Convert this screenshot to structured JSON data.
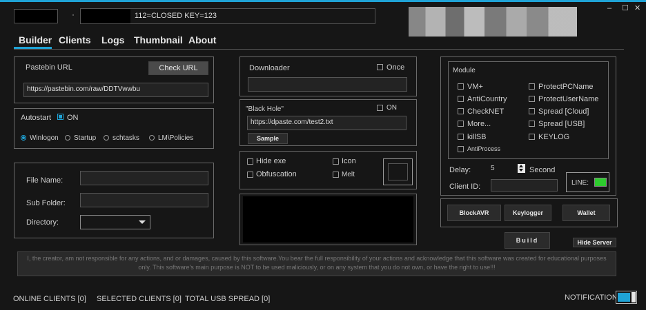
{
  "title_status": "112=CLOSED   KEY=123",
  "title_dot": "·",
  "window": {
    "minimize": "–",
    "maximize": "☐",
    "close": "✕"
  },
  "tabs": [
    "Builder",
    "Clients",
    "Logs",
    "Thumbnail",
    "About"
  ],
  "pastebin": {
    "label": "Pastebin URL",
    "check_button": "Check URL",
    "url": "https://pastebin.com/raw/DDTVwwbu"
  },
  "autostart": {
    "label": "Autostart",
    "on": "ON",
    "options": [
      "Winlogon",
      "Startup",
      "schtasks",
      "LM\\Policies"
    ],
    "selected": "Winlogon"
  },
  "file": {
    "file_name_label": "File Name:",
    "sub_folder_label": "Sub Folder:",
    "directory_label": "Directory:",
    "file_name": "",
    "sub_folder": "",
    "directory": ""
  },
  "downloader": {
    "label": "Downloader",
    "once": "Once",
    "url": ""
  },
  "blackhole": {
    "label": "\"Black Hole\"",
    "on": "ON",
    "url": "https://dpaste.com/test2.txt",
    "sample_button": "Sample"
  },
  "options": {
    "hide_exe": "Hide exe",
    "icon": "Icon",
    "obfuscation": "Obfuscation",
    "melt": "Melt"
  },
  "module": {
    "label": "Module",
    "left": [
      "VM+",
      "AntiCountry",
      "CheckNET",
      "More...",
      "killSB",
      "AntiProcess"
    ],
    "right": [
      "ProtectPCName",
      "ProtectUserName",
      "Spread [Cloud]",
      "Spread [USB]",
      "KEYLOG"
    ]
  },
  "delay": {
    "label": "Delay:",
    "value": "5",
    "unit": "Second"
  },
  "client_id": {
    "label": "Client ID:",
    "value": ""
  },
  "line": {
    "label": "LINE:",
    "color": "#2ecc2e"
  },
  "actions": {
    "block_avr": "BlockAVR",
    "keylogger": "Keylogger",
    "wallet": "Wallet"
  },
  "build_button": "Build",
  "hide_server_button": "Hide Server",
  "disclaimer": "I, the creator, am not responsible for any actions, and or damages, caused by this software.You bear the full responsibility of your actions and acknowledge that this software was created for educational purposes only. This software's main purpose is NOT to be used maliciously, or on any system that you do not own, or have the right to use!!!",
  "status": {
    "online": "ONLINE CLIENTS [0]",
    "selected": "SELECTED CLIENTS [0]",
    "usb": "TOTAL USB SPREAD [0]",
    "notification": "NOTIFICATION"
  },
  "colors": {
    "accent": "#1fa3d6",
    "line_green": "#2ecc2e",
    "background": "#161616"
  }
}
